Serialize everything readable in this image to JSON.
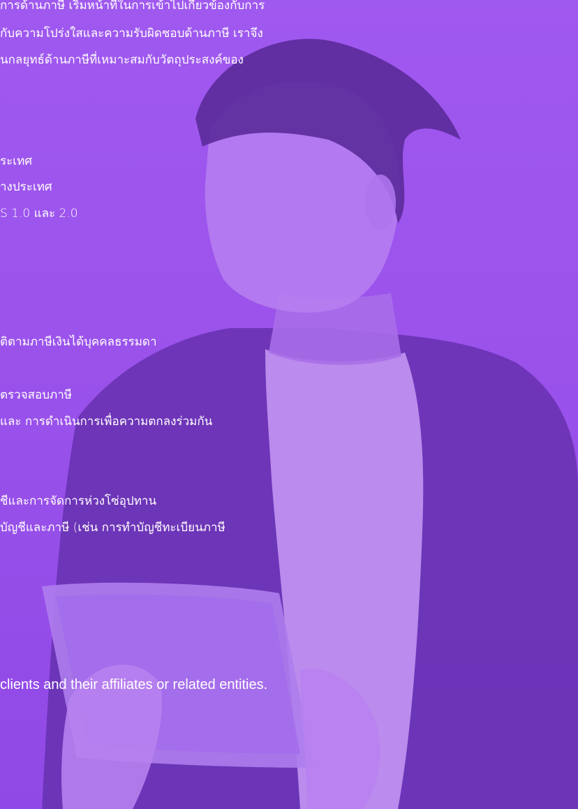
{
  "intro": {
    "lines": [
      "การด้านภาษี เริ่มหน้าที่ในการเข้าไปเกี่ยวข้องกับการ",
      "กับความโปร่งใสและความรับผิดชอบด้านภาษี เราจึง",
      "นกลยุทธ์ด้านภาษีที่เหมาะสมกับวัตถุประสงค์ของ"
    ]
  },
  "list_a": [
    "ระเทศ",
    "างประเทศ",
    "S 1.0 และ 2.0"
  ],
  "list_b": [
    "ติตามภาษีเงินได้บุคคลธรรมดา"
  ],
  "list_c": [
    "ตรวจสอบภาษี",
    "และ การดำเนินการเพื่อความตกลงร่วมกัน"
  ],
  "list_d": [
    "ชีและการจัดการห่วงโซ่อุปทาน",
    "บัญชีและภาษี (เช่น การทำบัญชีทะเบียนภาษี"
  ],
  "footnote": "clients and their affiliates or related entities.",
  "colors": {
    "overlay": "#9a52ec",
    "text": "#ffffff"
  }
}
